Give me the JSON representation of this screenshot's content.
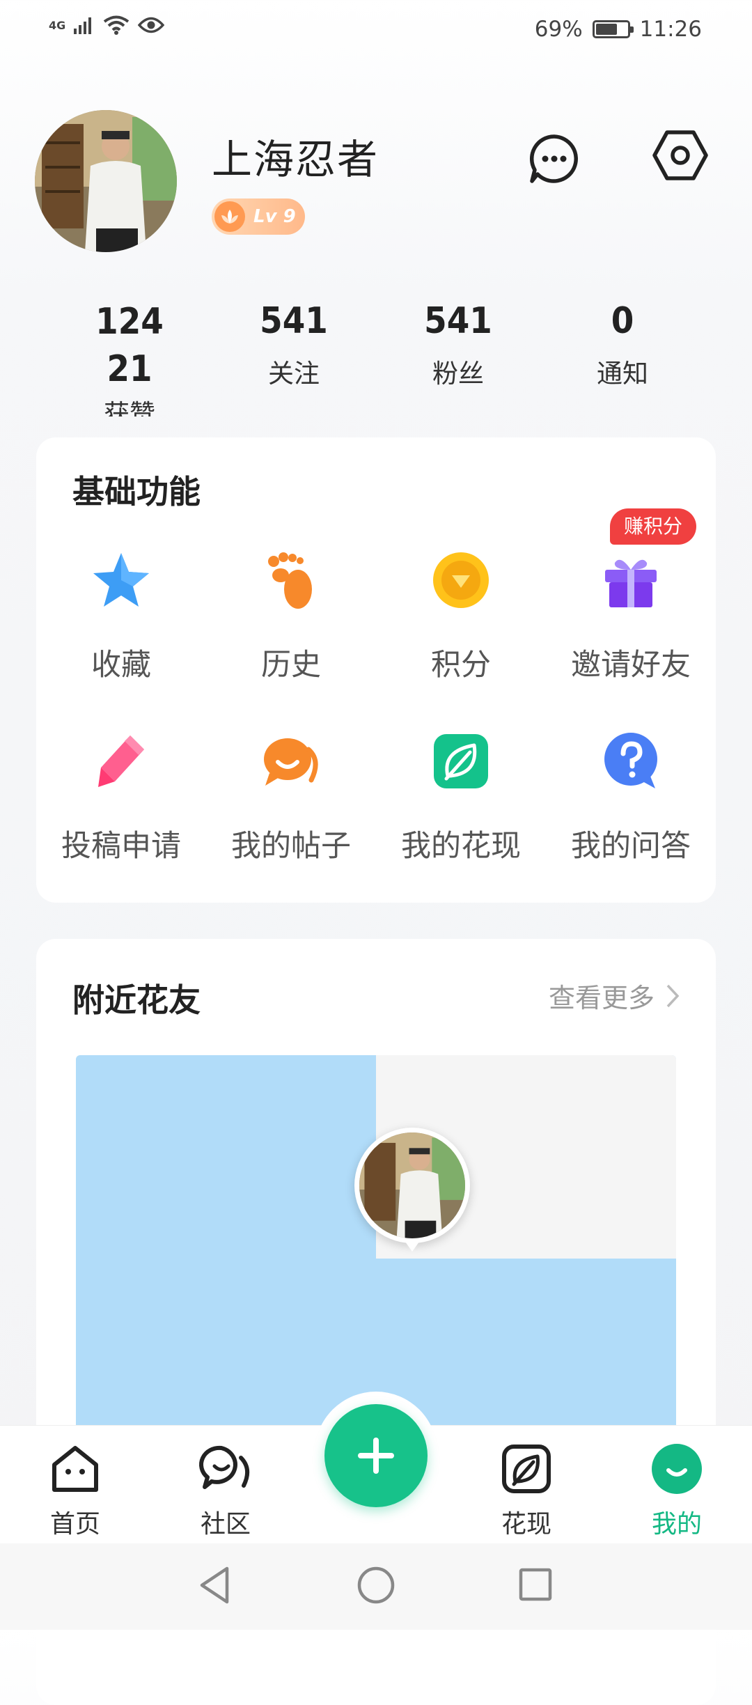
{
  "status_bar": {
    "network": "4G",
    "battery_percent": "69%",
    "battery_level": 0.69,
    "time": "11:26"
  },
  "profile": {
    "username": "上海忍者",
    "level": "Lv 9"
  },
  "stats": [
    {
      "value": "12421",
      "label": "获赞"
    },
    {
      "value": "541",
      "label": "关注"
    },
    {
      "value": "541",
      "label": "粉丝"
    },
    {
      "value": "0",
      "label": "通知"
    }
  ],
  "basic_functions": {
    "title": "基础功能",
    "earn_tag": "赚积分",
    "items": [
      {
        "label": "收藏",
        "icon": "star-icon"
      },
      {
        "label": "历史",
        "icon": "footprint-icon"
      },
      {
        "label": "积分",
        "icon": "points-coin-icon"
      },
      {
        "label": "邀请好友",
        "icon": "gift-icon"
      },
      {
        "label": "投稿申请",
        "icon": "pencil-icon"
      },
      {
        "label": "我的帖子",
        "icon": "post-bubble-icon"
      },
      {
        "label": "我的花现",
        "icon": "leaf-icon"
      },
      {
        "label": "我的问答",
        "icon": "question-icon"
      }
    ]
  },
  "nearby": {
    "title": "附近花友",
    "more_label": "查看更多"
  },
  "bottom_nav": {
    "items": [
      {
        "label": "首页",
        "icon": "home-icon"
      },
      {
        "label": "社区",
        "icon": "community-icon"
      },
      {
        "label": "花现",
        "icon": "leaf-icon"
      },
      {
        "label": "我的",
        "icon": "me-icon",
        "active": true
      }
    ],
    "fab_icon": "plus-icon"
  },
  "colors": {
    "accent": "#17c28a",
    "map_water": "#b1dcf9",
    "tag_red": "#f04040"
  }
}
